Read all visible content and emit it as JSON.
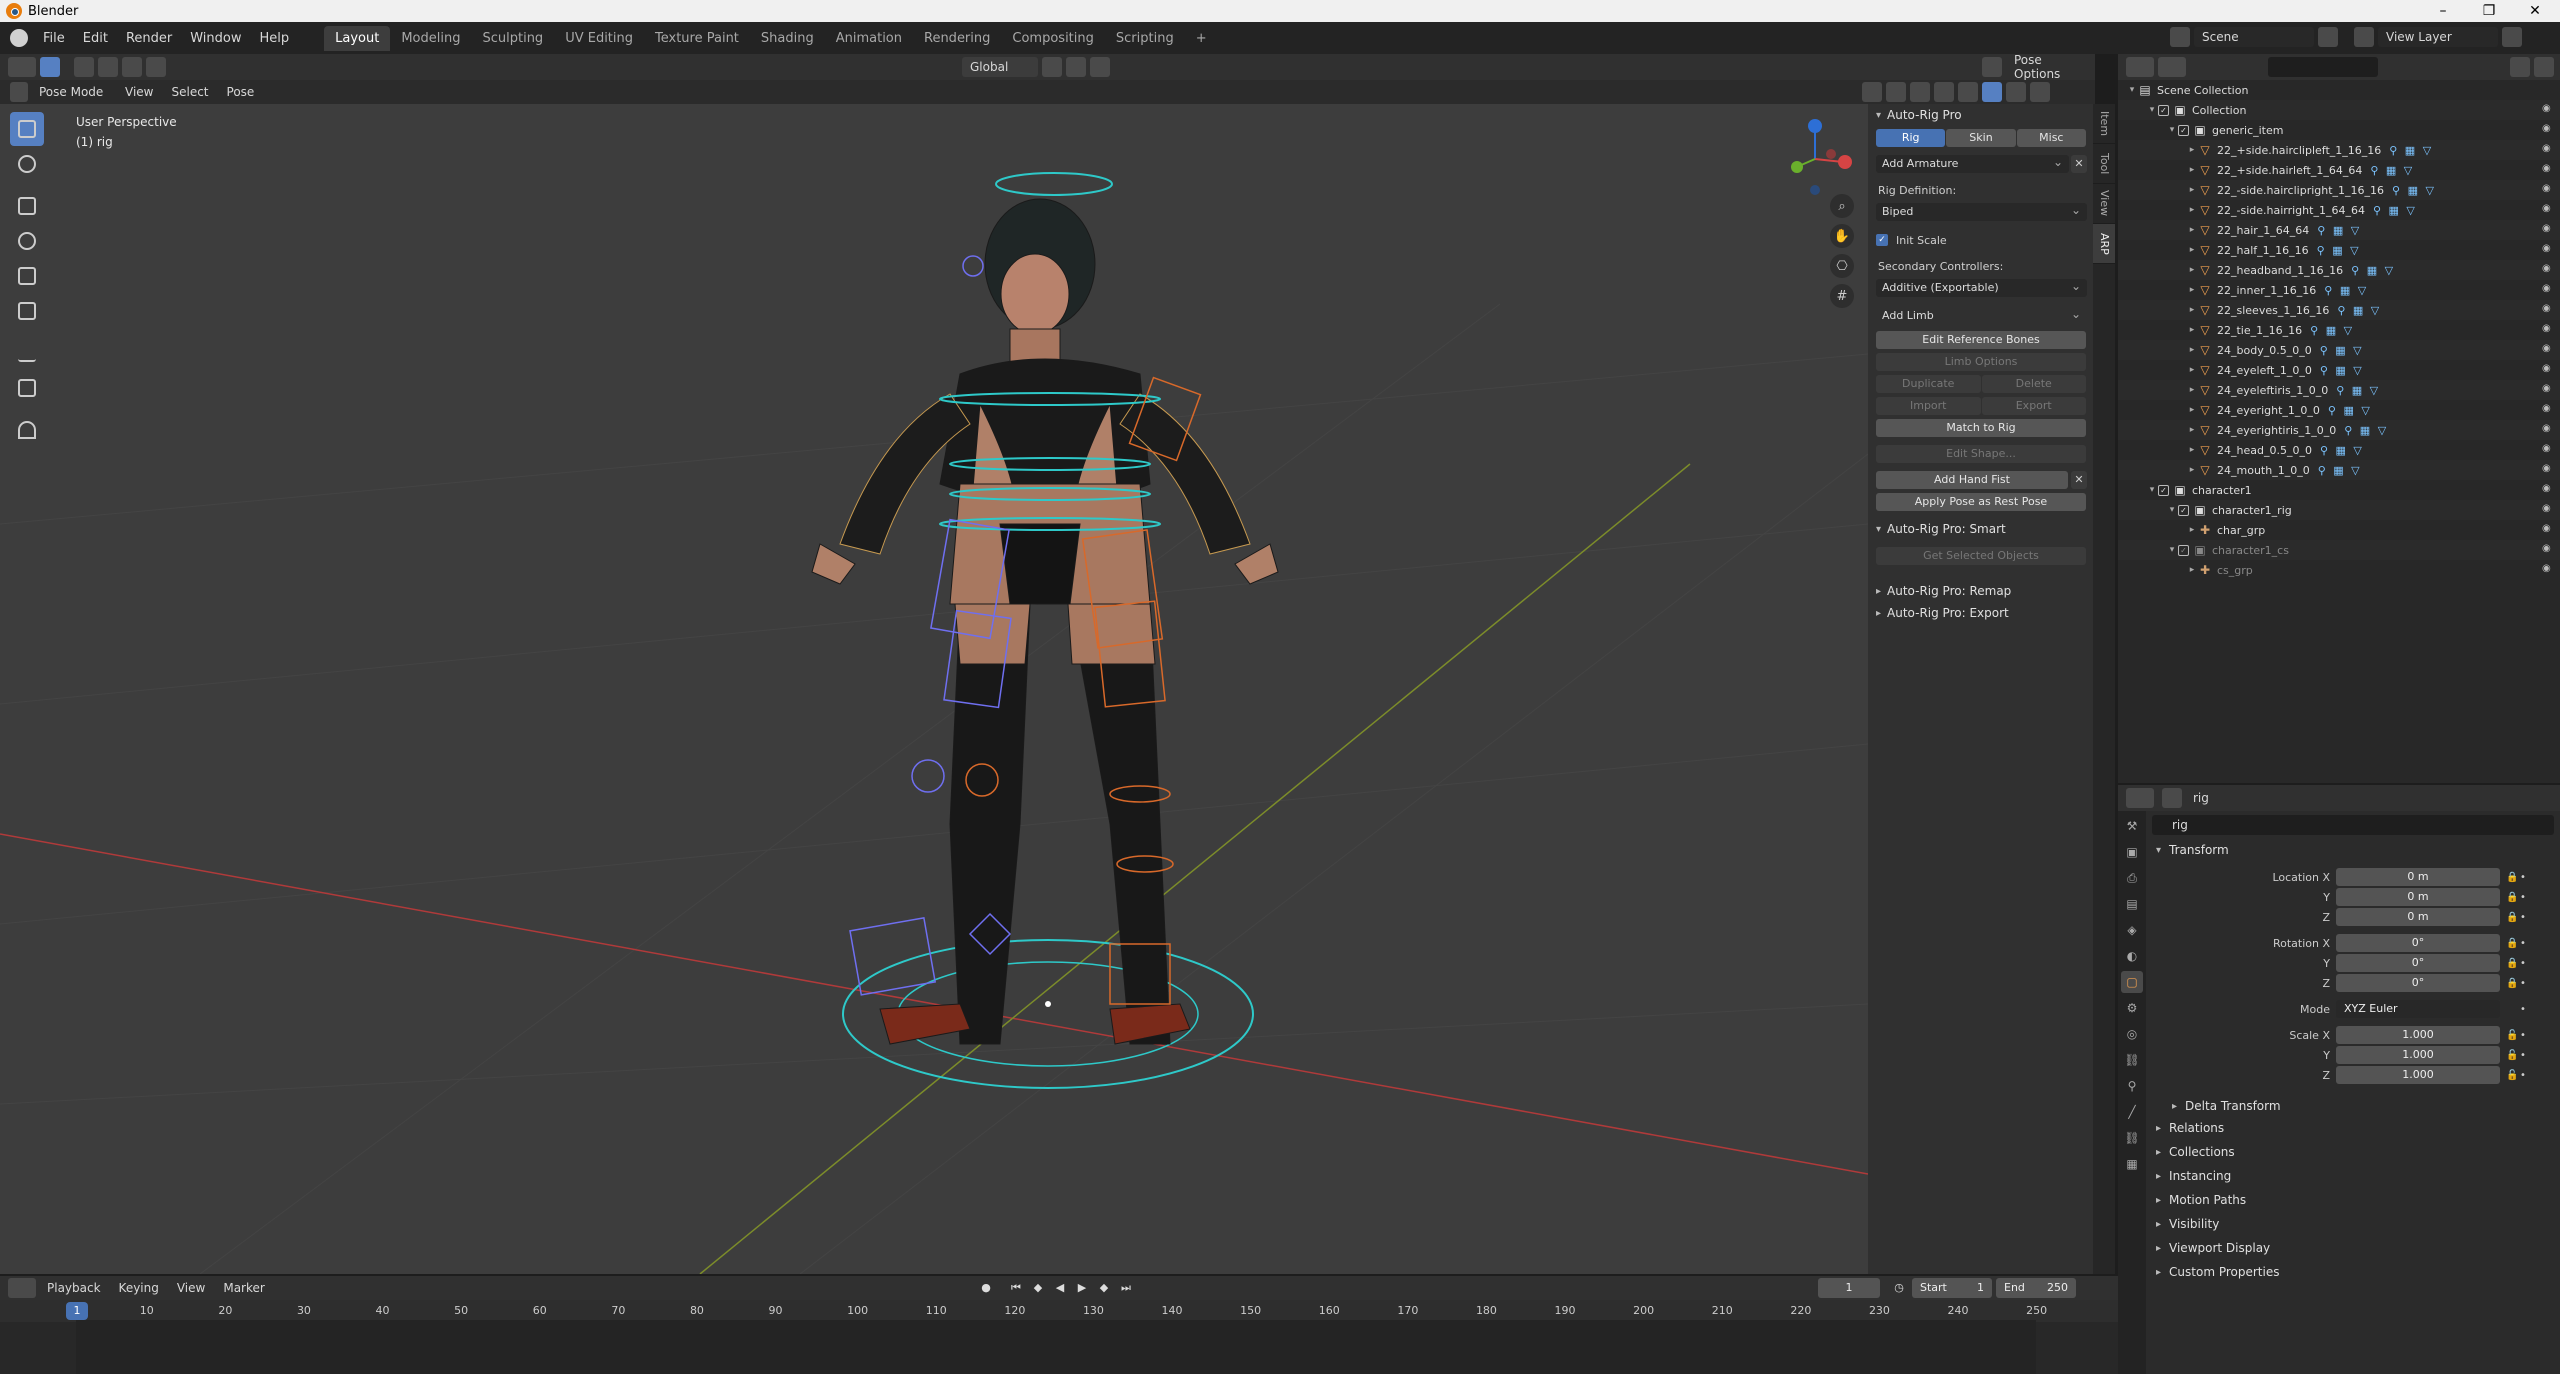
{
  "window": {
    "title": "Blender",
    "minimize": "–",
    "maximize": "❐",
    "close": "✕"
  },
  "menu": {
    "items": [
      "File",
      "Edit",
      "Render",
      "Window",
      "Help"
    ],
    "workspaces": [
      "Layout",
      "Modeling",
      "Sculpting",
      "UV Editing",
      "Texture Paint",
      "Shading",
      "Animation",
      "Rendering",
      "Compositing",
      "Scripting"
    ],
    "add_workspace": "+",
    "scene_name": "Scene",
    "view_layer": "View Layer"
  },
  "viewport_header": {
    "mode": "Pose Mode",
    "menus": [
      "View",
      "Select",
      "Pose"
    ],
    "transform_orientation": "Global",
    "pose_options": "Pose Options"
  },
  "viewport": {
    "perspective_label": "User Perspective",
    "object_label": "(1) rig"
  },
  "autorig": {
    "title": "Auto-Rig Pro",
    "tabs": [
      "Rig",
      "Skin",
      "Misc"
    ],
    "add_armature": "Add Armature",
    "rig_definition_label": "Rig Definition:",
    "rig_definition_value": "Biped",
    "init_scale_label": "Init Scale",
    "secondary_label": "Secondary Controllers:",
    "secondary_value": "Additive (Exportable)",
    "add_limb": "Add Limb",
    "edit_reference_bones": "Edit Reference Bones",
    "limb_options": "Limb Options",
    "duplicate": "Duplicate",
    "delete": "Delete",
    "import": "Import",
    "export": "Export",
    "match_to_rig": "Match to Rig",
    "edit_shape": "Edit Shape...",
    "add_hand_fist": "Add Hand Fist",
    "apply_pose": "Apply Pose as Rest Pose",
    "smart_title": "Auto-Rig Pro: Smart",
    "get_selected": "Get Selected Objects",
    "remap_title": "Auto-Rig Pro: Remap",
    "export_title": "Auto-Rig Pro: Export",
    "side_tabs": [
      "Item",
      "Tool",
      "View",
      "ARP"
    ]
  },
  "outliner": {
    "search_placeholder": "",
    "rows": [
      {
        "name": "Scene Collection",
        "depth": 0,
        "type": "scene"
      },
      {
        "name": "Collection",
        "depth": 1,
        "type": "collection"
      },
      {
        "name": "generic_item",
        "depth": 2,
        "type": "collection"
      },
      {
        "name": "22_+side.hairclipleft_1_16_16",
        "depth": 3,
        "type": "mesh"
      },
      {
        "name": "22_+side.hairleft_1_64_64",
        "depth": 3,
        "type": "mesh"
      },
      {
        "name": "22_-side.hairclipright_1_16_16",
        "depth": 3,
        "type": "mesh"
      },
      {
        "name": "22_-side.hairright_1_64_64",
        "depth": 3,
        "type": "mesh"
      },
      {
        "name": "22_hair_1_64_64",
        "depth": 3,
        "type": "mesh"
      },
      {
        "name": "22_half_1_16_16",
        "depth": 3,
        "type": "mesh"
      },
      {
        "name": "22_headband_1_16_16",
        "depth": 3,
        "type": "mesh"
      },
      {
        "name": "22_inner_1_16_16",
        "depth": 3,
        "type": "mesh"
      },
      {
        "name": "22_sleeves_1_16_16",
        "depth": 3,
        "type": "mesh"
      },
      {
        "name": "22_tie_1_16_16",
        "depth": 3,
        "type": "mesh"
      },
      {
        "name": "24_body_0.5_0_0",
        "depth": 3,
        "type": "mesh"
      },
      {
        "name": "24_eyeleft_1_0_0",
        "depth": 3,
        "type": "mesh"
      },
      {
        "name": "24_eyeleftiris_1_0_0",
        "depth": 3,
        "type": "mesh"
      },
      {
        "name": "24_eyeright_1_0_0",
        "depth": 3,
        "type": "mesh"
      },
      {
        "name": "24_eyerightiris_1_0_0",
        "depth": 3,
        "type": "mesh"
      },
      {
        "name": "24_head_0.5_0_0",
        "depth": 3,
        "type": "mesh"
      },
      {
        "name": "24_mouth_1_0_0",
        "depth": 3,
        "type": "mesh"
      },
      {
        "name": "character1",
        "depth": 1,
        "type": "collection"
      },
      {
        "name": "character1_rig",
        "depth": 2,
        "type": "collection"
      },
      {
        "name": "char_grp",
        "depth": 3,
        "type": "empty"
      },
      {
        "name": "character1_cs",
        "depth": 2,
        "type": "collection-dim"
      },
      {
        "name": "cs_grp",
        "depth": 3,
        "type": "empty-dim"
      }
    ]
  },
  "properties": {
    "object_name_header": "rig",
    "object_name": "rig",
    "transform_title": "Transform",
    "location": {
      "label": "Location X",
      "x": "0 m",
      "y": "0 m",
      "z": "0 m"
    },
    "rotation": {
      "label": "Rotation X",
      "x": "0°",
      "y": "0°",
      "z": "0°"
    },
    "mode_label": "Mode",
    "mode_value": "XYZ Euler",
    "scale": {
      "label": "Scale X",
      "x": "1.000",
      "y": "1.000",
      "z": "1.000"
    },
    "axis_y": "Y",
    "axis_z": "Z",
    "delta_transform": "Delta Transform",
    "sections": [
      "Relations",
      "Collections",
      "Instancing",
      "Motion Paths",
      "Visibility",
      "Viewport Display",
      "Custom Properties"
    ]
  },
  "timeline": {
    "menus": [
      "Playback",
      "Keying",
      "View",
      "Marker"
    ],
    "current_frame": "1",
    "start_label": "Start",
    "start": "1",
    "end_label": "End",
    "end": "250",
    "ticks": [
      "10",
      "20",
      "30",
      "40",
      "50",
      "60",
      "70",
      "80",
      "90",
      "100",
      "110",
      "120",
      "130",
      "140",
      "150",
      "160",
      "170",
      "180",
      "190",
      "200",
      "210",
      "220",
      "230",
      "240",
      "250"
    ]
  },
  "colors": {
    "accent": "#4772b3",
    "viewport_bg": "#3d3d3d",
    "bone_cyan": "#2ec9c9",
    "bone_orange": "#d8692a",
    "bone_blue": "#6f6ff0"
  }
}
